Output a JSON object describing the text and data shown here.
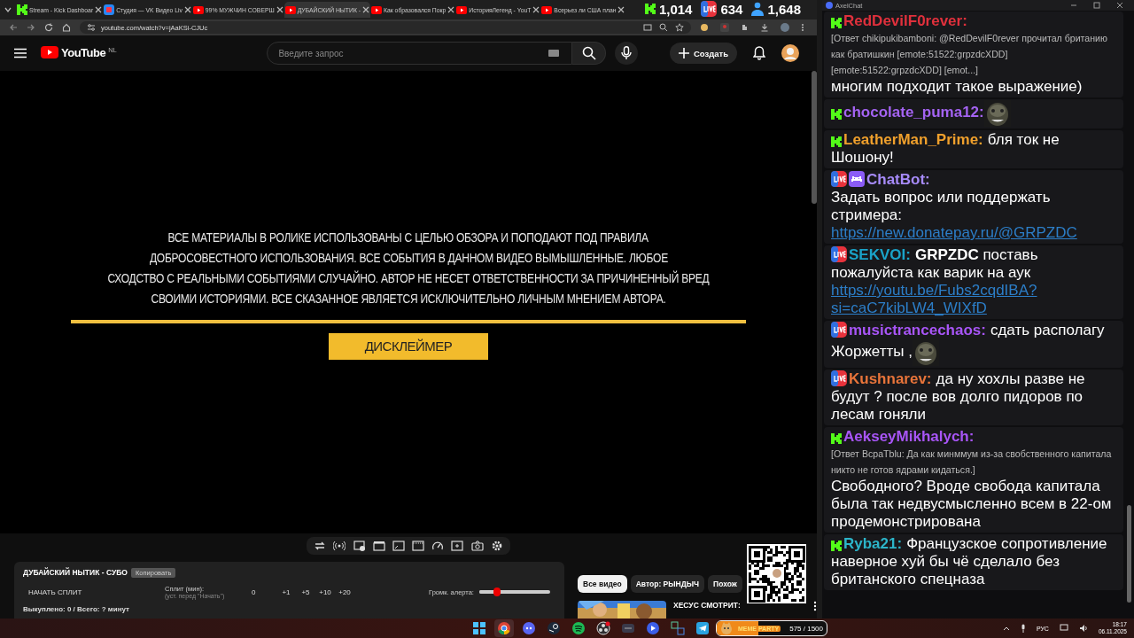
{
  "browser": {
    "tabs": [
      {
        "title": "Stream - Kick Dashboar",
        "kind": "kick",
        "selected": false
      },
      {
        "title": "Студия — VK Видео Liv",
        "kind": "vk",
        "selected": false
      },
      {
        "title": "99% МУЖЧИН СОВЕРШ",
        "kind": "youtube",
        "selected": false
      },
      {
        "title": "ДУБАЙСКИЙ НЫТИК -",
        "kind": "youtube",
        "selected": true
      },
      {
        "title": "Как образовался Покр",
        "kind": "youtube",
        "selected": false
      },
      {
        "title": "ИсторияЛегенд - YouT",
        "kind": "youtube",
        "selected": false
      },
      {
        "title": "Всерьез ли США план",
        "kind": "youtube",
        "selected": false
      }
    ],
    "url": "youtube.com/watch?v=jAaKSi-CJUc",
    "stream_stats": [
      {
        "kind": "kick",
        "value": "1,014"
      },
      {
        "kind": "live",
        "value": "634"
      },
      {
        "kind": "viewers",
        "value": "1,648"
      }
    ]
  },
  "youtube": {
    "logo": "YouTube",
    "region": "NL",
    "search": {
      "placeholder": "Введите запрос"
    },
    "create_button": "Создать"
  },
  "video": {
    "disclaimer": [
      "ВСЕ МАТЕРИАЛЫ В РОЛИКЕ ИСПОЛЬЗОВАНЫ С ЦЕЛЬЮ ОБЗОРА И ПОПОДАЮТ ПОД ПРАВИЛА",
      "ДОБРОСОВЕСТНОГО ИСПОЛЬЗОВАНИЯ. ВСЕ СОБЫТИЯ В ДАННОМ ВИДЕО ВЫМЫШЛЕННЫЕ. ЛЮБОЕ",
      "СХОДСТВО С РЕАЛЬНЫМИ СОБЫТИЯМИ СЛУЧАЙНО. АВТОР НЕ НЕСЕТ ОТВЕТСТВЕННОСТИ ЗА ПРИЧИНЕННЫЙ ВРЕД",
      "СВОИМИ ИСТОРИЯМИ. ВСЕ СКАЗАННОЕ ЯВЛЯЕТСЯ ИСКЛЮЧИТЕЛЬНО ЛИЧНЫМ МНЕНИЕМ АВТОРА."
    ],
    "banner": "ДИСКЛЕЙМЕР"
  },
  "split_panel": {
    "title": "ДУБАЙСКИЙ НЫТИК - СУБО",
    "copy_button": "Копировать",
    "start_button": "НАЧАТЬ СПЛИТ",
    "split_label": "Сплит (мин):",
    "split_hint": "(уст. перед \"Начать\")",
    "split_value": "0",
    "add_buttons": [
      "+1",
      "+5",
      "+10",
      "+20"
    ],
    "volume_label": "Громк. алерта:",
    "volume": {
      "level": 0.25
    },
    "summary": "Выкуплено: 0 / Всего: ? минут"
  },
  "filter_chips": [
    {
      "label": "Все видео",
      "selected": true
    },
    {
      "label": "Автор: РЫНДЫЧ",
      "selected": false
    },
    {
      "label": "Похож",
      "selected": false
    }
  ],
  "suggested_video": {
    "title": "ХЕСУС СМОТРИТ:"
  },
  "chat": {
    "title": "AxelChat",
    "messages": [
      {
        "kind": "kick",
        "author": "RedDevilF0rever:",
        "color": "#e0303c",
        "reply": "[Ответ chikipukibamboni: @RedDevilF0rever прочитал британию как братишкин [emote:51522:grpzdcXDD][emote:51522:grpzdcXDD] [emot...]",
        "text": "многим подходит такое выражение)"
      },
      {
        "kind": "kick",
        "author": "chocolate_puma12:",
        "color": "#a463f2",
        "emote": true
      },
      {
        "kind": "kick",
        "author": "LeatherMan_Prime:",
        "color": "#f0a02c",
        "text": "бля ток не Шошону!"
      },
      {
        "kind": "live",
        "bot": true,
        "author": "ChatBot:",
        "color": "#a78bfa",
        "text_below": true,
        "text": "Задать вопрос или поддержать стримера:",
        "link": "https://new.donatepay.ru/@GRPZDC"
      },
      {
        "kind": "live",
        "author": "SEKVOI:",
        "color": "#1aa3c8",
        "text": "**GRPZDC** поставь пожалуйста как варик на аук",
        "link": "https://youtu.be/Fubs2cqdIBA?si=caC7kibLW4_WIXfD"
      },
      {
        "kind": "live",
        "author": "musictrancechaos:",
        "color": "#a855f7",
        "text": "сдать располагу Жоржетты ,",
        "emote": true
      },
      {
        "kind": "live",
        "author": "Kushnarev:",
        "color": "#e8743a",
        "text": "да ну хохлы разве не будут ? после вов долго пидоров по лесам гоняли"
      },
      {
        "kind": "kick",
        "author": "AekseyMikhalych:",
        "color": "#a855f7",
        "reply": "[Ответ BcpaTblu: Да как минммум из-за свобственного капитала никто не готов ядрами кидаться.]",
        "text": "Свободного? Вроде свобода капитала была так недвусмысленно всем в 22-ом продемонстрирована"
      },
      {
        "kind": "kick",
        "author": "Ryba21:",
        "color": "#2cb5c9",
        "text": "Французское сопротивление наверное хуй бы чё сделало без британского спецназа"
      }
    ]
  },
  "meme_party": {
    "title": "MEME PARTY",
    "count": "575 / 1500",
    "level": 0.38
  },
  "taskbar": {
    "apps": [
      {
        "kind": "windows"
      },
      {
        "kind": "chrome",
        "selected": true
      },
      {
        "kind": "discord",
        "selected": false
      },
      {
        "kind": "steam",
        "selected": false
      },
      {
        "kind": "spotify",
        "selected": false
      },
      {
        "kind": "obs",
        "selected": false
      },
      {
        "kind": "media",
        "selected": false
      },
      {
        "kind": "play",
        "selected": false
      },
      {
        "kind": "tool",
        "selected": false
      },
      {
        "kind": "telegram",
        "selected": false
      }
    ],
    "language": "РУС",
    "time": "18:17",
    "date": "06.11.2025"
  }
}
